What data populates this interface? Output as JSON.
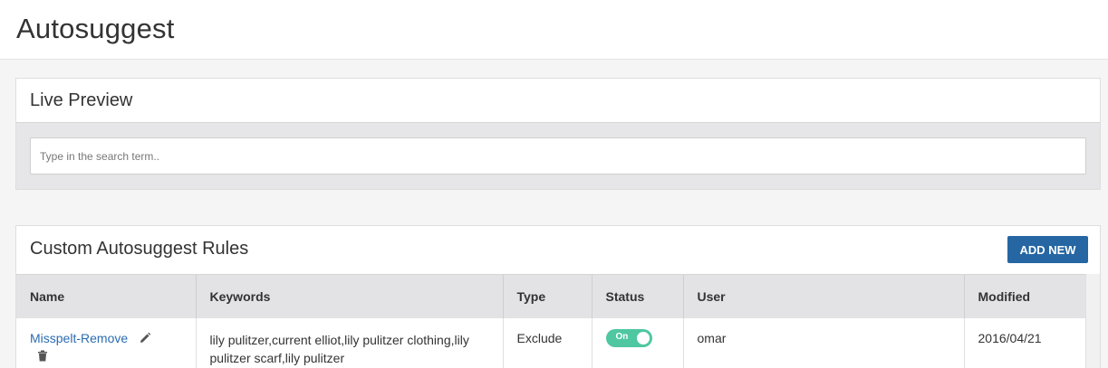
{
  "header": {
    "title": "Autosuggest"
  },
  "live_preview": {
    "title": "Live Preview",
    "search_placeholder": "Type in the search term..",
    "search_value": ""
  },
  "rules": {
    "title": "Custom Autosuggest Rules",
    "add_button_label": "ADD NEW",
    "columns": [
      "Name",
      "Keywords",
      "Type",
      "Status",
      "User",
      "Modified"
    ],
    "rows": [
      {
        "name": "Misspelt-Remove",
        "keywords": "lily pulitzer,current elliot,lily pulitzer clothing,lily pulitzer scarf,lily pulitzer",
        "type": "Exclude",
        "status": "On",
        "user": "omar",
        "modified": "2016/04/21"
      }
    ]
  },
  "colors": {
    "accent": "#2566a3",
    "link": "#2a6cb0",
    "toggle_on": "#4fc7a1",
    "header_bg": "#e3e3e6"
  },
  "icons": {
    "edit": "pencil-icon",
    "delete": "trash-icon"
  }
}
